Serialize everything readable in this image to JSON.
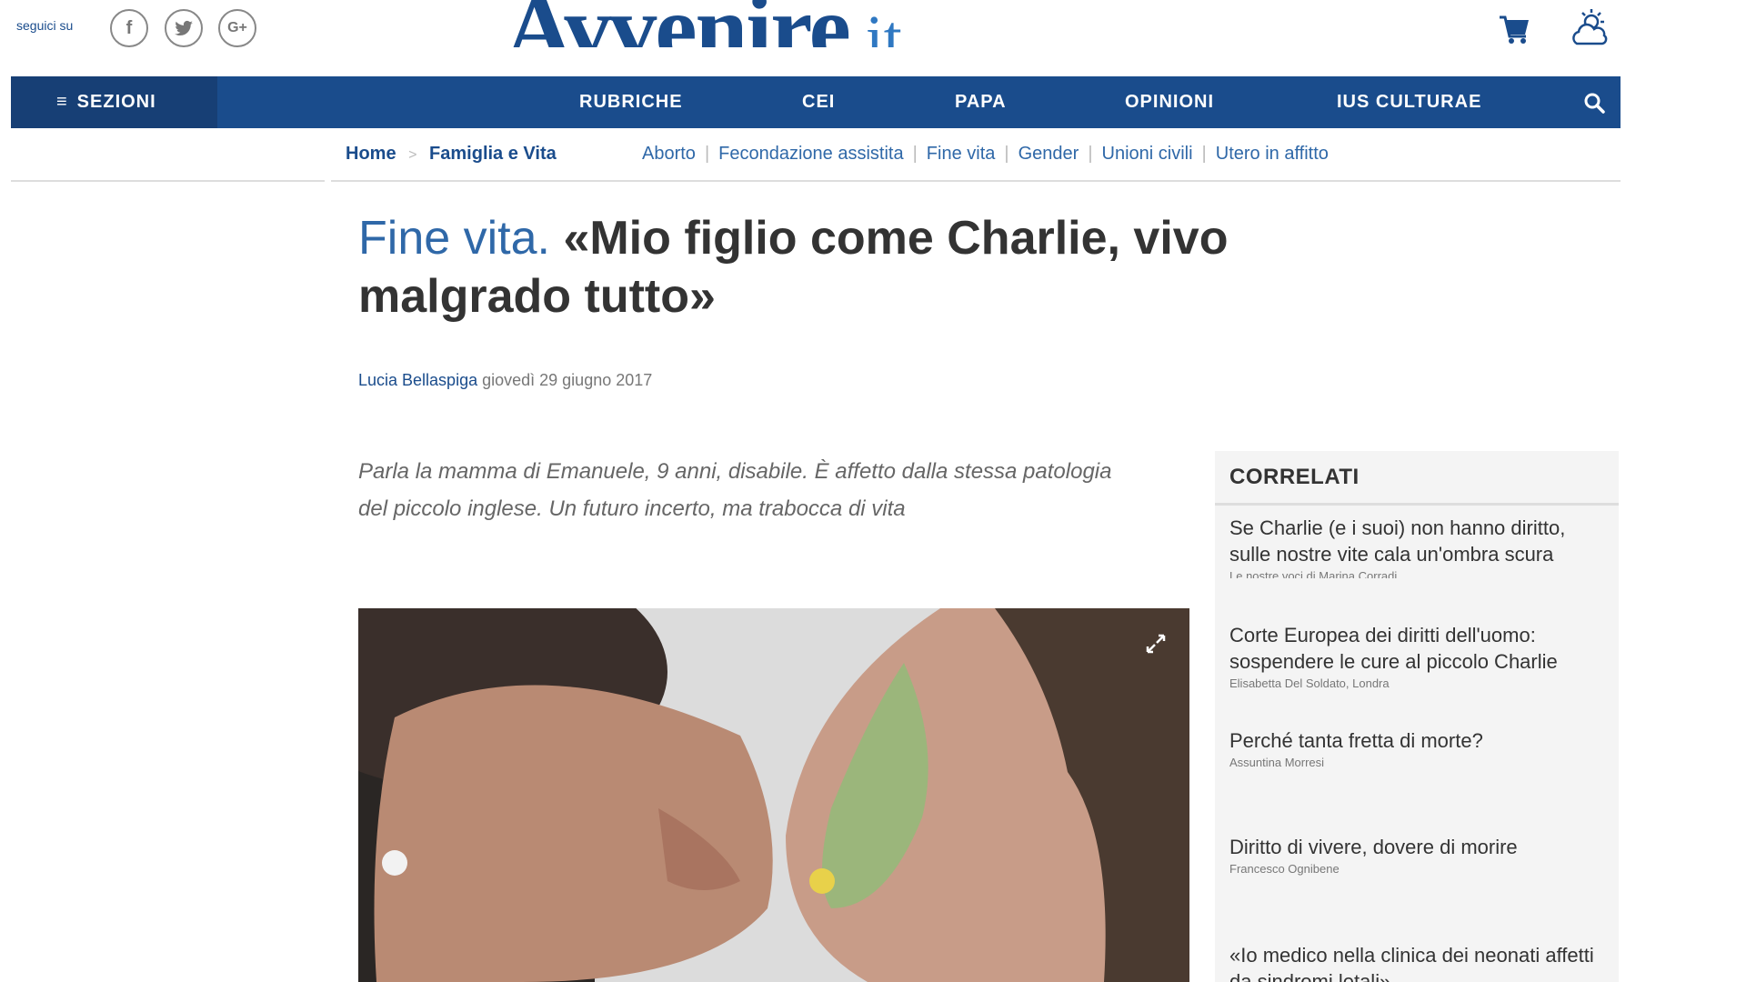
{
  "header": {
    "follow_label": "seguici su",
    "social": [
      "f",
      "t",
      "G+"
    ],
    "logo_main": "Avvenire",
    "logo_tld": ".it",
    "icons": [
      "cart-icon",
      "weather-icon"
    ]
  },
  "nav": {
    "sections_label": "SEZIONI",
    "items": [
      "RUBRICHE",
      "CEI",
      "PAPA",
      "OPINIONI",
      "IUS CULTURAE"
    ]
  },
  "breadcrumb": {
    "home": "Home",
    "separator": ">",
    "category": "Famiglia e Vita"
  },
  "tags": [
    "Aborto",
    "Fecondazione assistita",
    "Fine vita",
    "Gender",
    "Unioni civili",
    "Utero in affitto"
  ],
  "article": {
    "kicker": "Fine vita.",
    "title": "«Mio figlio come Charlie, vivo malgrado tutto»",
    "author": "Lucia Bellaspiga",
    "date": "giovedì 29 giugno 2017",
    "summary": "Parla la mamma di Emanuele, 9 anni, disabile. È affetto dalla stessa patologia del piccolo inglese. Un futuro incerto, ma trabocca di vita"
  },
  "sidebar": {
    "title": "CORRELATI",
    "items": [
      {
        "title": "Se Charlie (e i suoi) non hanno diritto, sulle nostre vite cala un'ombra scura",
        "author": "Le nostre voci di Marina Corradi"
      },
      {
        "title": "Corte Europea dei diritti dell'uomo: sospendere le cure al piccolo Charlie",
        "author": "Elisabetta Del Soldato, Londra"
      },
      {
        "title": "Perché tanta fretta di morte?",
        "author": "Assuntina Morresi"
      },
      {
        "title": "Diritto di vivere, dovere di morire",
        "author": "Francesco Ognibene"
      },
      {
        "title": "«Io medico nella clinica dei neonati affetti da sindromi letali»",
        "author": ""
      }
    ]
  },
  "colors": {
    "brand_blue": "#1a4c8c",
    "link_blue": "#2f68a8",
    "sidebar_bg": "#f4f4f4"
  }
}
